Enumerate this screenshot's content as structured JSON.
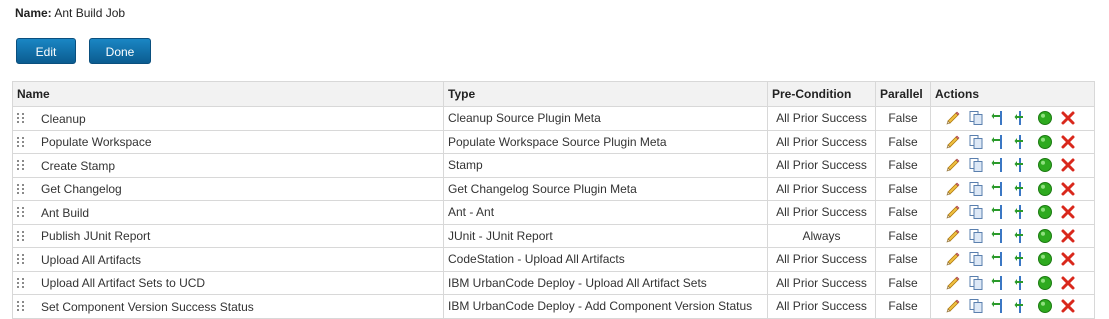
{
  "job": {
    "name_label": "Name:",
    "name_value": "Ant Build Job"
  },
  "buttons": {
    "edit": "Edit",
    "done": "Done"
  },
  "table": {
    "headers": {
      "name": "Name",
      "type": "Type",
      "precondition": "Pre-Condition",
      "parallel": "Parallel",
      "actions": "Actions"
    },
    "rows": [
      {
        "name": "Cleanup",
        "type": "Cleanup Source Plugin Meta",
        "precondition": "All Prior Success",
        "parallel": "False"
      },
      {
        "name": "Populate Workspace",
        "type": "Populate Workspace Source Plugin Meta",
        "precondition": "All Prior Success",
        "parallel": "False"
      },
      {
        "name": "Create Stamp",
        "type": "Stamp",
        "precondition": "All Prior Success",
        "parallel": "False"
      },
      {
        "name": "Get Changelog",
        "type": "Get Changelog Source Plugin Meta",
        "precondition": "All Prior Success",
        "parallel": "False"
      },
      {
        "name": "Ant Build",
        "type": "Ant - Ant",
        "precondition": "All Prior Success",
        "parallel": "False"
      },
      {
        "name": "Publish JUnit Report",
        "type": "JUnit - JUnit Report",
        "precondition": "Always",
        "parallel": "False"
      },
      {
        "name": "Upload All Artifacts",
        "type": "CodeStation - Upload All Artifacts",
        "precondition": "All Prior Success",
        "parallel": "False"
      },
      {
        "name": "Upload All Artifact Sets to UCD",
        "type": "IBM UrbanCode Deploy - Upload All Artifact Sets",
        "precondition": "All Prior Success",
        "parallel": "False"
      },
      {
        "name": "Set Component Version Success Status",
        "type": "IBM UrbanCode Deploy - Add Component Version Status",
        "precondition": "All Prior Success",
        "parallel": "False"
      }
    ],
    "row_actions": [
      "edit-icon",
      "copy-icon",
      "insert-before-icon",
      "insert-after-icon",
      "activate-icon",
      "delete-icon"
    ]
  },
  "colors": {
    "button": "#0b6aa8",
    "activate": "#2eaa1f",
    "delete": "#d9281c",
    "edit": "#e8b020",
    "arrow": "#2a8f2a"
  }
}
